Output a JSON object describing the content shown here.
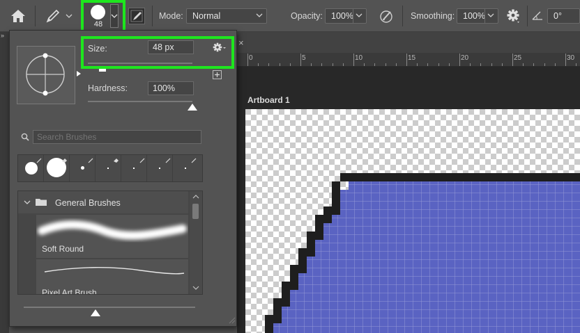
{
  "options_bar": {
    "brush_size_value": "48",
    "mode_label": "Mode:",
    "mode_value": "Normal",
    "opacity_label": "Opacity:",
    "opacity_value": "100%",
    "smoothing_label": "Smoothing:",
    "smoothing_value": "100%",
    "angle_value": "0°"
  },
  "brush_panel": {
    "size_label": "Size:",
    "size_value": "48 px",
    "size_fraction": 0.14,
    "hardness_label": "Hardness:",
    "hardness_value": "100%",
    "hardness_fraction": 1.0,
    "search_placeholder": "Search Brushes",
    "group_name": "General Brushes",
    "brushes": [
      "Soft Round",
      "Pixel Art Brush"
    ],
    "preview_size_fraction": 0.42
  },
  "document": {
    "artboard_title": "Artboard 1",
    "ruler_ticks": [
      "0",
      "5",
      "10",
      "15",
      "20",
      "25",
      "30"
    ]
  },
  "colors": {
    "highlight": "#1ee61e",
    "artwork_fill": "#5a63c2",
    "artwork_outline": "#1e1e1e"
  },
  "icons": {
    "home": "home-icon",
    "brush": "brush-icon",
    "pressure": "pressure-brush-icon",
    "airbrush": "airbrush-icon",
    "settings": "gear-icon",
    "angle": "angle-icon"
  }
}
